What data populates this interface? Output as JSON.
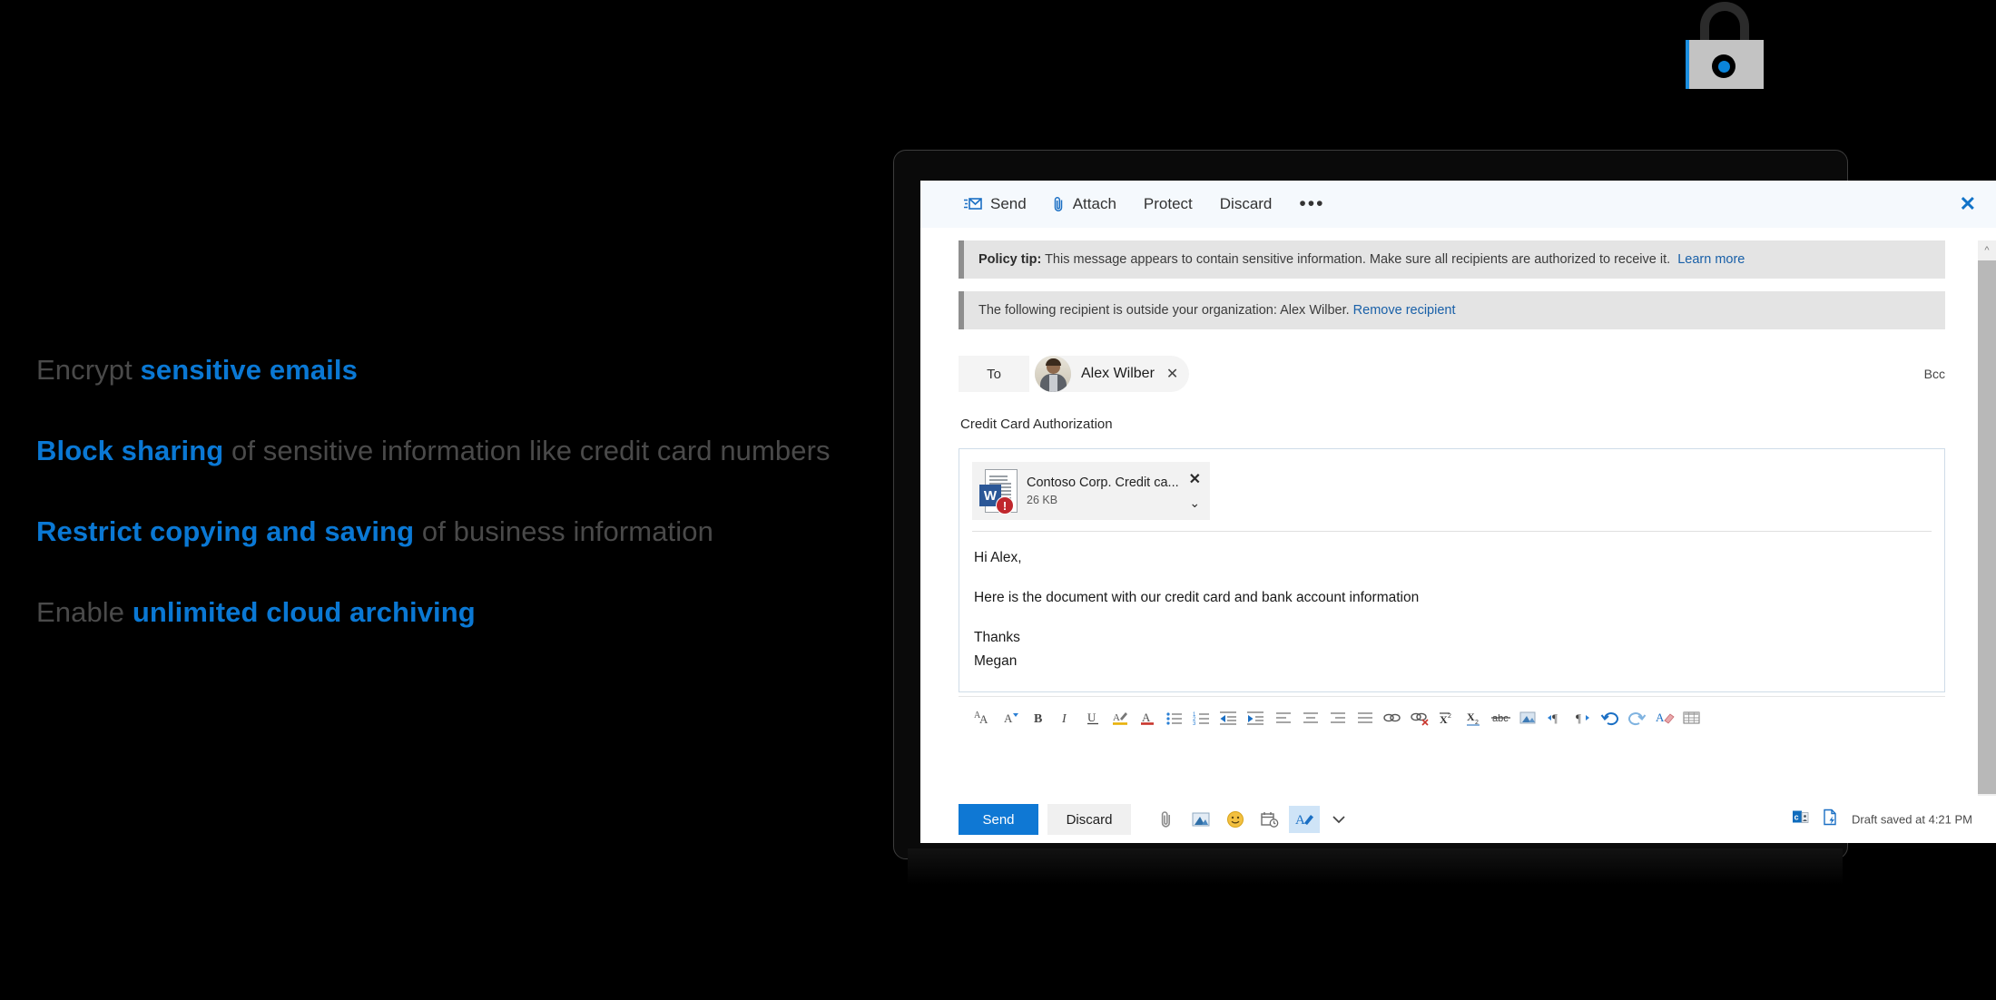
{
  "marketing": {
    "lines": [
      {
        "pre": "Encrypt ",
        "bold": "sensitive emails",
        "post": ""
      },
      {
        "pre": "",
        "bold": "Block sharing",
        "post": " of sensitive information like credit card numbers"
      },
      {
        "pre": "",
        "bold": "Restrict copying and saving",
        "post": " of business information"
      },
      {
        "pre": "Enable ",
        "bold": "unlimited cloud archiving",
        "post": ""
      }
    ],
    "accent_color": "#0a78d4",
    "text_color": "#4a4a4a"
  },
  "padlock": {
    "icon": "padlock-icon",
    "body_color": "#c3c3c3",
    "shackle_color": "#2b2b2b",
    "accent_color": "#0a84da"
  },
  "compose": {
    "commandbar": {
      "send_label": "Send",
      "attach_label": "Attach",
      "protect_label": "Protect",
      "discard_label": "Discard",
      "more_label": "•••",
      "close_label": "✕"
    },
    "policy_tip": {
      "strong": "Policy tip:",
      "text": " This message appears to contain sensitive information. Make sure all recipients are authorized to receive it.",
      "link": "Learn more"
    },
    "external_tip": {
      "text": "The following recipient is outside your organization: Alex Wilber.",
      "link": "Remove recipient"
    },
    "to_label": "To",
    "recipient": {
      "name": "Alex Wilber",
      "remove": "✕"
    },
    "bcc_label": "Bcc",
    "subject": "Credit Card Authorization",
    "attachment": {
      "name": "Contoso Corp. Credit ca...",
      "size": "26 KB",
      "remove": "✕",
      "expand": "⌄",
      "file_type": "word-document"
    },
    "body": [
      "Hi Alex,",
      "Here is the document with our credit card and bank account information",
      "Thanks"
    ],
    "body_signature": "Megan",
    "format_toolbar": [
      "font-size-icon",
      "font-color-dropdown-icon",
      "bold-icon",
      "italic-icon",
      "underline-icon",
      "highlight-icon",
      "font-color-icon",
      "bulleted-list-icon",
      "numbered-list-icon",
      "decrease-indent-icon",
      "increase-indent-icon",
      "align-left-icon",
      "align-center-icon",
      "align-right-icon",
      "justify-icon",
      "insert-link-icon",
      "remove-link-icon",
      "superscript-icon",
      "subscript-icon",
      "strikethrough-icon",
      "insert-image-icon",
      "ltr-icon",
      "rtl-icon",
      "undo-icon",
      "redo-icon",
      "clear-formatting-icon",
      "insert-table-icon"
    ],
    "actionbar": {
      "send_label": "Send",
      "discard_label": "Discard",
      "icons": [
        "attach-icon",
        "insert-picture-icon",
        "emoji-icon",
        "schedule-icon",
        "formatting-icon",
        "more-options-chevron-icon"
      ],
      "status_icons": [
        "outlook-addin-icon",
        "draft-icon"
      ],
      "draft_status": "Draft saved at 4:21 PM"
    },
    "accent_color": "#0f78d4"
  }
}
